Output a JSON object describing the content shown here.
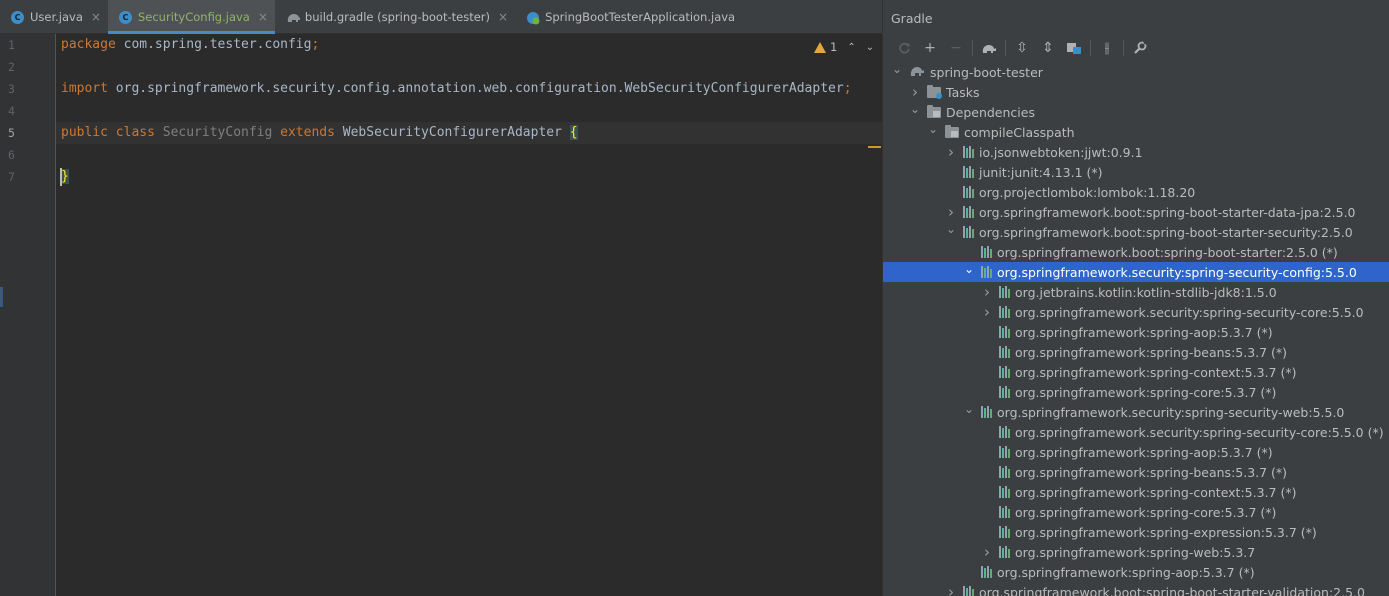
{
  "editor": {
    "tabs": [
      {
        "label": "User.java",
        "icon": "java-class-icon",
        "active": false
      },
      {
        "label": "SecurityConfig.java",
        "icon": "java-class-icon",
        "active": true
      },
      {
        "label": "build.gradle (spring-boot-tester)",
        "icon": "gradle-icon",
        "active": false
      },
      {
        "label": "SpringBootTesterApplication.java",
        "icon": "spring-boot-icon",
        "active": false
      }
    ],
    "close_glyph": "×",
    "line_numbers": [
      "1",
      "2",
      "3",
      "4",
      "5",
      "6",
      "7"
    ],
    "current_line": "5",
    "code": {
      "l1_kw": "package",
      "l1_rest": " com.spring.tester.config",
      "l3_kw": "import",
      "l3_rest": " org.springframework.security.config.annotation.web.configuration.WebSecurityConfigurerAdapter",
      "semi": ";",
      "l5_kw1": "public class",
      "l5_name": " SecurityConfig ",
      "l5_kw2": "extends",
      "l5_rest": " WebSecurityConfigurerAdapter ",
      "open_brace": "{",
      "close_brace": "}"
    },
    "inspection": {
      "warning_count": "1",
      "up_glyph": "⌃",
      "down_glyph": "⌄"
    }
  },
  "gradle": {
    "title": "Gradle",
    "toolbar": [
      "reload-icon",
      "add-icon",
      "remove-icon",
      "gradle-execute-icon",
      "expand-all-icon",
      "collapse-all-icon",
      "group-modules-icon",
      "toggle-offline-icon",
      "settings-wrench-icon"
    ],
    "toolbar_glyphs": {
      "add": "+",
      "remove": "−",
      "expand": "⇳",
      "collapse": "⇕",
      "offline": "⫲",
      "settings": "🔧"
    },
    "tree": [
      {
        "label": "spring-boot-tester",
        "level": 0,
        "arrow": "expanded",
        "icon": "gradle-elephant-icon"
      },
      {
        "label": "Tasks",
        "level": 1,
        "arrow": "collapsed",
        "icon": "tasks-folder-icon"
      },
      {
        "label": "Dependencies",
        "level": 1,
        "arrow": "expanded",
        "icon": "dependencies-folder-icon"
      },
      {
        "label": "compileClasspath",
        "level": 2,
        "arrow": "expanded",
        "icon": "dependencies-folder-icon"
      },
      {
        "label": "io.jsonwebtoken:jjwt:0.9.1",
        "level": 3,
        "arrow": "collapsed",
        "icon": "library-icon"
      },
      {
        "label": "junit:junit:4.13.1 (*)",
        "level": 3,
        "arrow": "none",
        "icon": "library-icon"
      },
      {
        "label": "org.projectlombok:lombok:1.18.20",
        "level": 3,
        "arrow": "none",
        "icon": "library-icon"
      },
      {
        "label": "org.springframework.boot:spring-boot-starter-data-jpa:2.5.0",
        "level": 3,
        "arrow": "collapsed",
        "icon": "library-icon"
      },
      {
        "label": "org.springframework.boot:spring-boot-starter-security:2.5.0",
        "level": 3,
        "arrow": "expanded",
        "icon": "library-icon"
      },
      {
        "label": "org.springframework.boot:spring-boot-starter:2.5.0 (*)",
        "level": 4,
        "arrow": "none",
        "icon": "library-icon"
      },
      {
        "label": "org.springframework.security:spring-security-config:5.5.0",
        "level": 4,
        "arrow": "expanded",
        "icon": "library-icon",
        "selected": true
      },
      {
        "label": "org.jetbrains.kotlin:kotlin-stdlib-jdk8:1.5.0",
        "level": 5,
        "arrow": "collapsed",
        "icon": "library-icon"
      },
      {
        "label": "org.springframework.security:spring-security-core:5.5.0",
        "level": 5,
        "arrow": "collapsed",
        "icon": "library-icon"
      },
      {
        "label": "org.springframework:spring-aop:5.3.7 (*)",
        "level": 5,
        "arrow": "none",
        "icon": "library-icon"
      },
      {
        "label": "org.springframework:spring-beans:5.3.7 (*)",
        "level": 5,
        "arrow": "none",
        "icon": "library-icon"
      },
      {
        "label": "org.springframework:spring-context:5.3.7 (*)",
        "level": 5,
        "arrow": "none",
        "icon": "library-icon"
      },
      {
        "label": "org.springframework:spring-core:5.3.7 (*)",
        "level": 5,
        "arrow": "none",
        "icon": "library-icon"
      },
      {
        "label": "org.springframework.security:spring-security-web:5.5.0",
        "level": 4,
        "arrow": "expanded",
        "icon": "library-icon"
      },
      {
        "label": "org.springframework.security:spring-security-core:5.5.0 (*)",
        "level": 5,
        "arrow": "none",
        "icon": "library-icon"
      },
      {
        "label": "org.springframework:spring-aop:5.3.7 (*)",
        "level": 5,
        "arrow": "none",
        "icon": "library-icon"
      },
      {
        "label": "org.springframework:spring-beans:5.3.7 (*)",
        "level": 5,
        "arrow": "none",
        "icon": "library-icon"
      },
      {
        "label": "org.springframework:spring-context:5.3.7 (*)",
        "level": 5,
        "arrow": "none",
        "icon": "library-icon"
      },
      {
        "label": "org.springframework:spring-core:5.3.7 (*)",
        "level": 5,
        "arrow": "none",
        "icon": "library-icon"
      },
      {
        "label": "org.springframework:spring-expression:5.3.7 (*)",
        "level": 5,
        "arrow": "none",
        "icon": "library-icon"
      },
      {
        "label": "org.springframework:spring-web:5.3.7",
        "level": 5,
        "arrow": "collapsed",
        "icon": "library-icon"
      },
      {
        "label": "org.springframework:spring-aop:5.3.7 (*)",
        "level": 4,
        "arrow": "none",
        "icon": "library-icon"
      },
      {
        "label": "org.springframework.boot:spring-boot-starter-validation:2.5.0",
        "level": 3,
        "arrow": "collapsed",
        "icon": "library-icon"
      }
    ]
  },
  "colors": {
    "editor_bg": "#2b2b2b",
    "keyword": "#cc7832",
    "selection": "#2f65ca",
    "active_tab_text": "#8fb567",
    "warning": "#e0a93c"
  }
}
